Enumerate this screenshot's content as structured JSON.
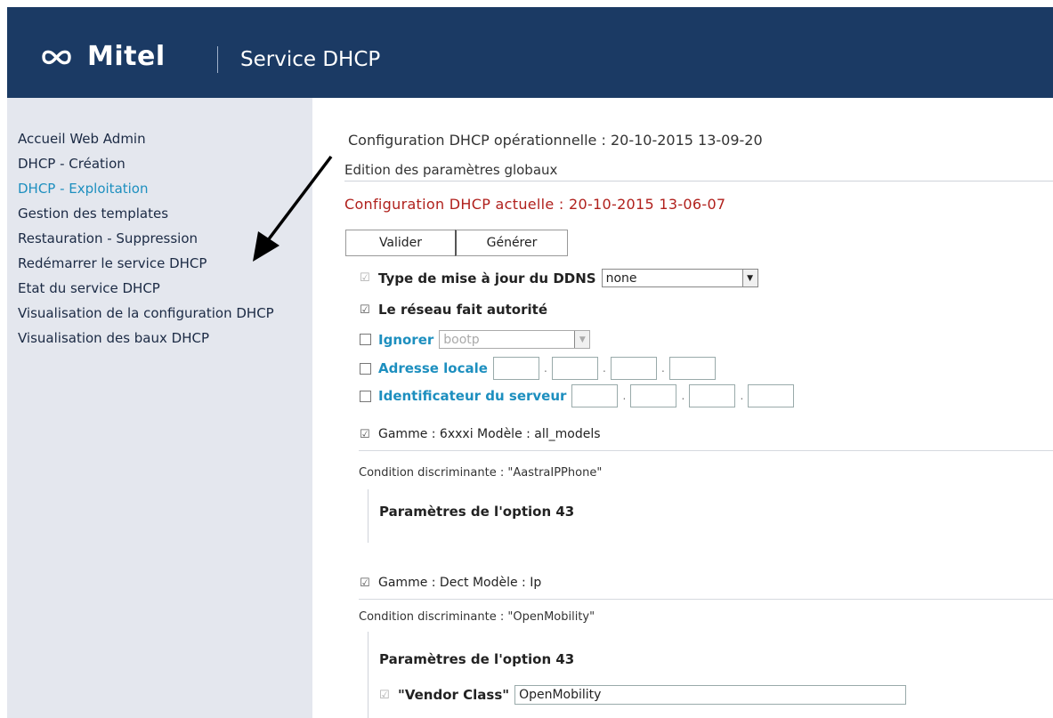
{
  "header": {
    "brand": "Mitel",
    "title": "Service DHCP",
    "colors": {
      "header_bg": "#1b3a64",
      "sidebar_bg": "#e4e7ee",
      "active_nav": "#1d8fbf",
      "alert_red": "#b0201c"
    }
  },
  "sidebar": {
    "items": [
      {
        "label": "Accueil Web Admin",
        "active": false
      },
      {
        "label": "DHCP - Création",
        "active": false
      },
      {
        "label": "DHCP - Exploitation",
        "active": true
      },
      {
        "label": "Gestion des templates",
        "active": false
      },
      {
        "label": "Restauration - Suppression",
        "active": false
      },
      {
        "label": "Redémarrer le service DHCP",
        "active": false
      },
      {
        "label": "Etat du service DHCP",
        "active": false
      },
      {
        "label": "Visualisation de la configuration DHCP",
        "active": false
      },
      {
        "label": "Visualisation des baux DHCP",
        "active": false
      }
    ]
  },
  "main": {
    "operational": "Configuration DHCP opérationnelle : 20-10-2015 13-09-20",
    "edit_title": "Edition des paramètres globaux",
    "actual": "Configuration DHCP actuelle : 20-10-2015 13-06-07",
    "buttons": {
      "validate": "Valider",
      "generate": "Générer"
    },
    "params": {
      "ddns": {
        "label": "Type de mise à jour du DDNS",
        "value": "none",
        "checked": true
      },
      "authority": {
        "label": "Le réseau fait autorité",
        "checked": true
      },
      "ignore": {
        "label": "Ignorer",
        "value": "bootp",
        "checked": false
      },
      "local_address": {
        "label": "Adresse locale",
        "checked": false
      },
      "server_id": {
        "label": "Identificateur du serveur",
        "checked": false
      }
    },
    "groups": [
      {
        "gamme": "Gamme : 6xxxi Modèle : all_models",
        "condition": "Condition discriminante : \"AastraIPPhone\"",
        "option_title": "Paramètres de l'option 43"
      },
      {
        "gamme": "Gamme : Dect Modèle : Ip",
        "condition": "Condition discriminante : \"OpenMobility\"",
        "option_title": "Paramètres de l'option 43",
        "vendor_label": "\"Vendor Class\"",
        "vendor_value": "OpenMobility"
      }
    ]
  },
  "icons": [
    "mitel-logo-icon",
    "checkbox-checked-icon",
    "checkbox-empty-icon",
    "dropdown-arrow-icon",
    "pointer-arrow-icon"
  ]
}
